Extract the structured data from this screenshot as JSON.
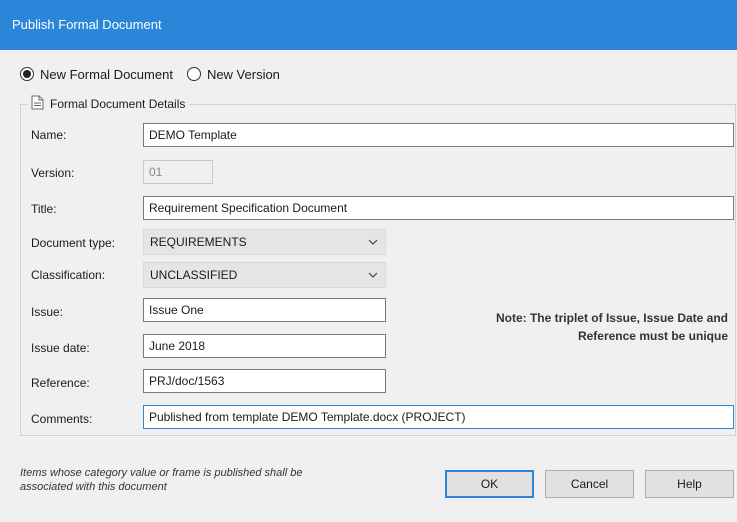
{
  "window": {
    "title": "Publish Formal Document"
  },
  "mode": {
    "options": [
      {
        "label": "New Formal Document",
        "selected": true
      },
      {
        "label": "New Version",
        "selected": false
      }
    ]
  },
  "group": {
    "title": "Formal Document Details",
    "icon": "document-icon"
  },
  "fields": {
    "name": {
      "label": "Name:",
      "value": "DEMO Template"
    },
    "version": {
      "label": "Version:",
      "value": "01"
    },
    "title": {
      "label": "Title:",
      "value": "Requirement Specification Document"
    },
    "document_type": {
      "label": "Document type:",
      "value": "REQUIREMENTS"
    },
    "classification": {
      "label": "Classification:",
      "value": "UNCLASSIFIED"
    },
    "issue": {
      "label": "Issue:",
      "value": "Issue One"
    },
    "issue_date": {
      "label": "Issue date:",
      "value": "June 2018"
    },
    "reference": {
      "label": "Reference:",
      "value": "PRJ/doc/1563"
    },
    "comments": {
      "label": "Comments:",
      "value": "Published from template DEMO Template.docx (PROJECT)"
    }
  },
  "note": {
    "line1": "Note: The triplet of Issue, Issue Date and",
    "line2": "Reference must be unique"
  },
  "footer": {
    "line1": "Items whose category value or frame is published shall be",
    "line2": "associated with this document"
  },
  "buttons": {
    "ok": "OK",
    "cancel": "Cancel",
    "help": "Help"
  },
  "colors": {
    "titlebar": "#2b86d9",
    "focus": "#2b86d9",
    "dialog_bg": "#f0f0f0"
  }
}
